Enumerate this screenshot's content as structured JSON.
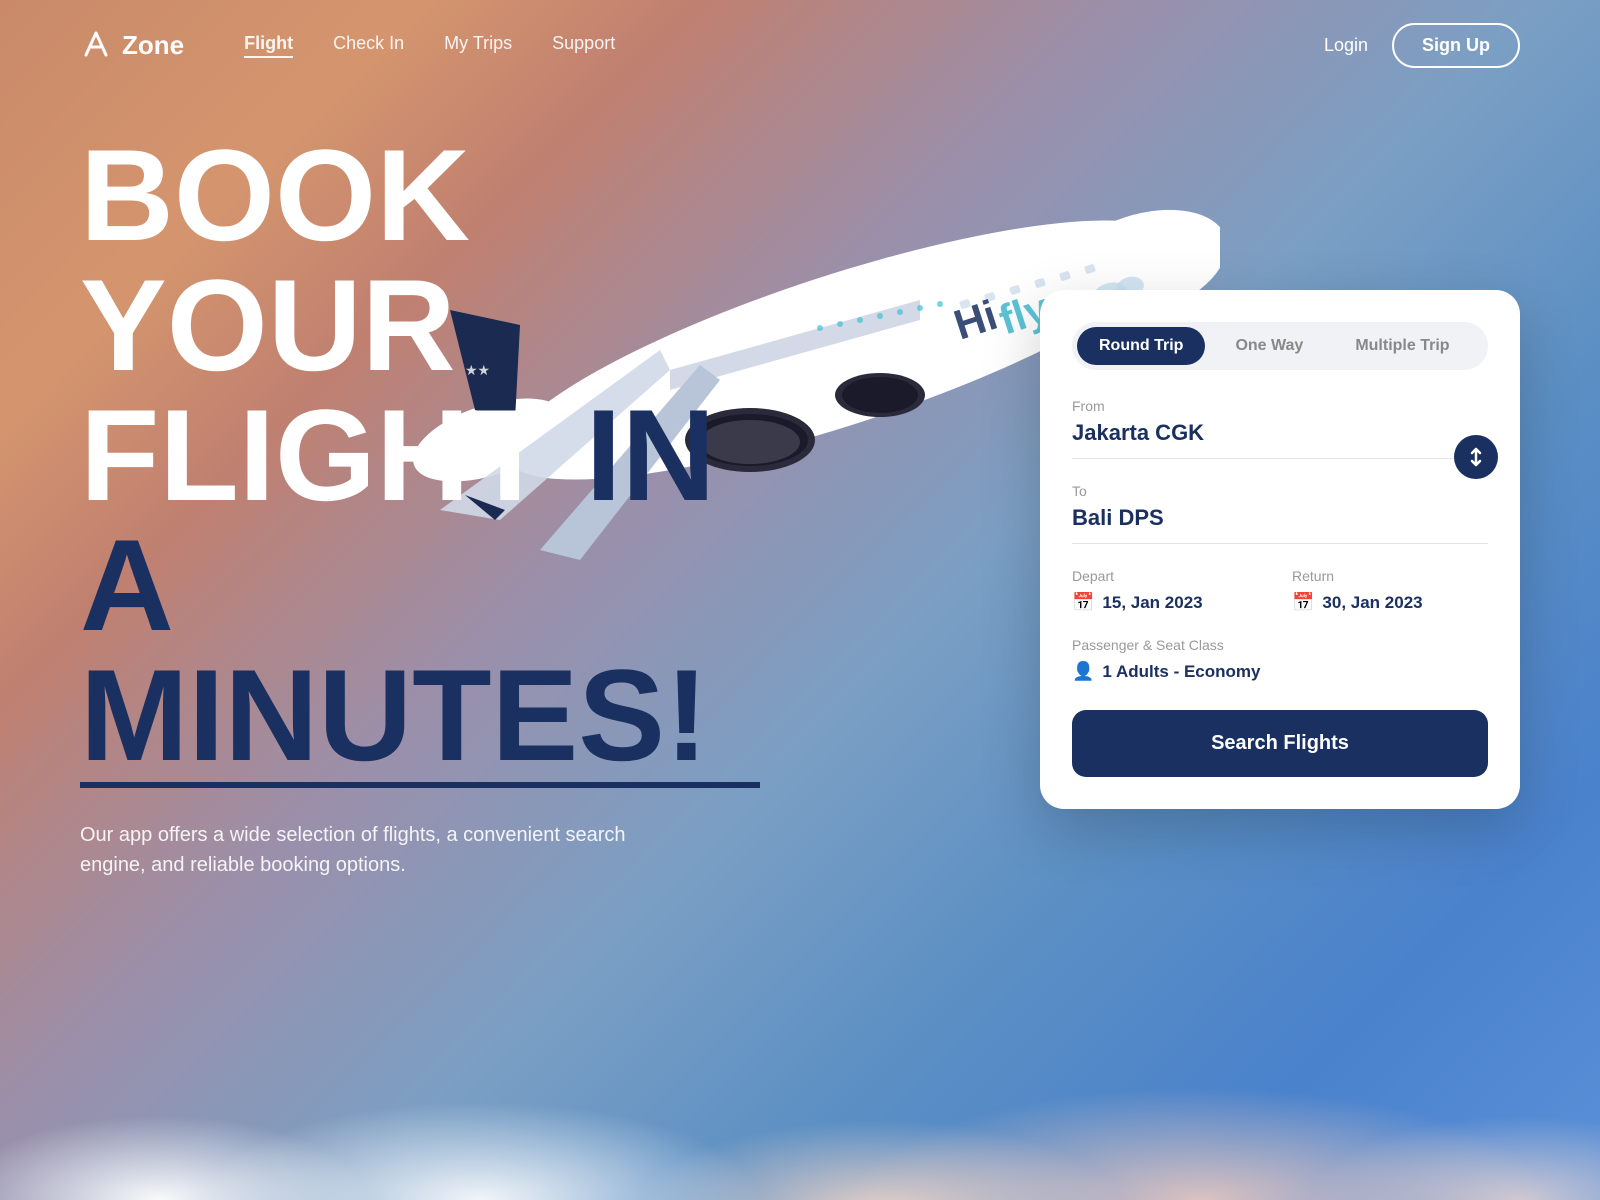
{
  "brand": {
    "name": "Zone",
    "logo_icon": "A"
  },
  "nav": {
    "links": [
      {
        "label": "Flight",
        "active": true
      },
      {
        "label": "Check In",
        "active": false
      },
      {
        "label": "My Trips",
        "active": false
      },
      {
        "label": "Support",
        "active": false
      }
    ],
    "login": "Login",
    "signup": "Sign Up"
  },
  "hero": {
    "title_line1": "BOOK",
    "title_line2": "YOUR",
    "title_line3_part1": "FLIGHT",
    "title_line3_part2": "IN",
    "title_line4": "A MINUTES!",
    "subtitle": "Our app offers a wide selection of flights, a convenient search engine, and reliable booking options."
  },
  "booking": {
    "trip_types": [
      {
        "label": "Round Trip",
        "active": true
      },
      {
        "label": "One Way",
        "active": false
      },
      {
        "label": "Multiple Trip",
        "active": false
      }
    ],
    "from_label": "From",
    "from_value": "Jakarta CGK",
    "to_label": "To",
    "to_value": "Bali DPS",
    "depart_label": "Depart",
    "depart_value": "15, Jan 2023",
    "return_label": "Return",
    "return_value": "30, Jan 2023",
    "passenger_label": "Passenger & Seat Class",
    "passenger_value": "1 Adults - Economy",
    "search_button": "Search Flights",
    "swap_icon": "⇅"
  }
}
